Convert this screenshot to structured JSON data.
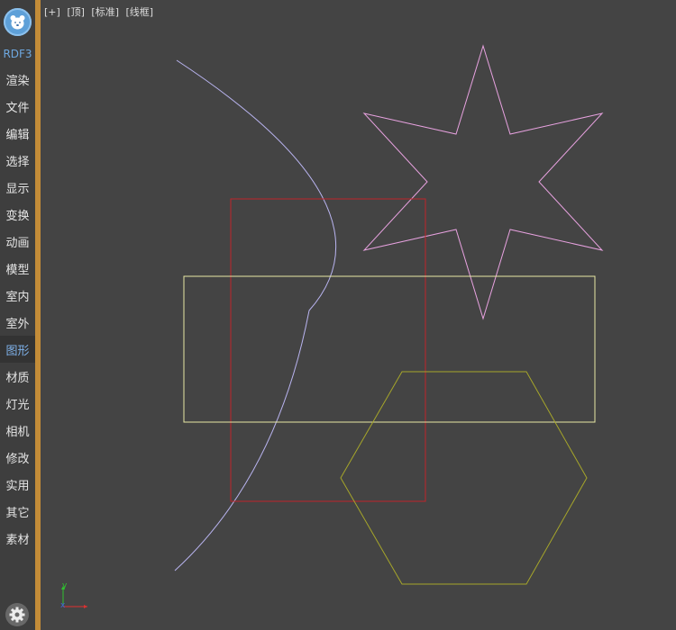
{
  "sidebar": {
    "brand": "RDF3",
    "items": [
      {
        "label": "渲染"
      },
      {
        "label": "文件"
      },
      {
        "label": "编辑"
      },
      {
        "label": "选择"
      },
      {
        "label": "显示"
      },
      {
        "label": "变换"
      },
      {
        "label": "动画"
      },
      {
        "label": "模型"
      },
      {
        "label": "室内"
      },
      {
        "label": "室外"
      },
      {
        "label": "图形",
        "active": true
      },
      {
        "label": "材质"
      },
      {
        "label": "灯光"
      },
      {
        "label": "相机"
      },
      {
        "label": "修改"
      },
      {
        "label": "实用"
      },
      {
        "label": "其它"
      },
      {
        "label": "素材"
      }
    ]
  },
  "viewport": {
    "labels": [
      "[+]",
      "[顶]",
      "[标准]",
      "[线框]"
    ],
    "axis": {
      "x": "x",
      "y": "y"
    }
  },
  "colors": {
    "viewport_bg": "#444444",
    "sidebar_accent": "#c38c38",
    "active_text": "#7fb2ea",
    "arc": "#b9b4f0",
    "star": "#e8a2e0",
    "red_rect": "#c0242a",
    "yellow_rect": "#e8e8a4",
    "hexagon": "#a6a62a",
    "axis_x": "#e03030",
    "axis_y": "#30c030"
  },
  "icons": {
    "logo": "bear-logo-icon",
    "settings": "gear-icon"
  }
}
